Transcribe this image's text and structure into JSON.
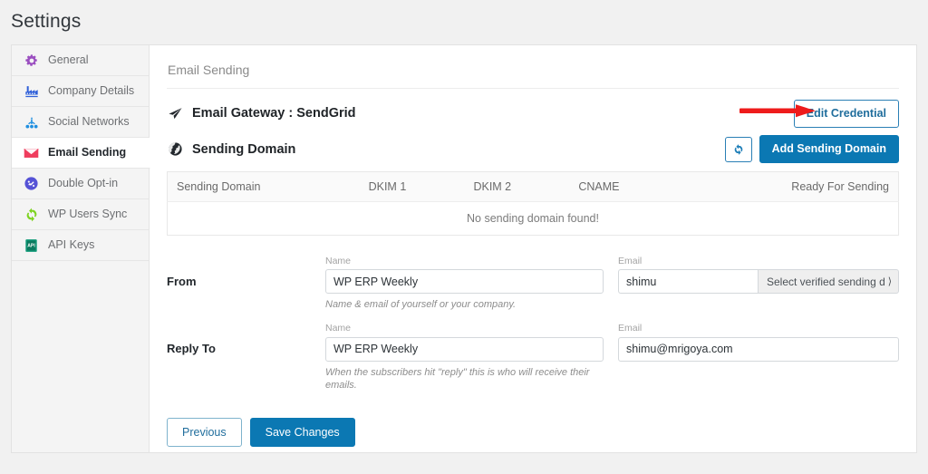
{
  "page": {
    "title": "Settings"
  },
  "sidebar": {
    "items": [
      {
        "label": "General",
        "icon": "gear-icon",
        "color": "#9b4fc0",
        "active": false
      },
      {
        "label": "Company Details",
        "icon": "factory-icon",
        "color": "#2f5fd8",
        "active": false
      },
      {
        "label": "Social Networks",
        "icon": "share-nodes-icon",
        "color": "#1f8fe0",
        "active": false
      },
      {
        "label": "Email Sending",
        "icon": "envelope-icon",
        "color": "#ef3d5e",
        "active": true
      },
      {
        "label": "Double Opt-in",
        "icon": "opt-in-icon",
        "color": "#5552d6",
        "active": false
      },
      {
        "label": "WP Users Sync",
        "icon": "sync-icon",
        "color": "#7ed321",
        "active": false
      },
      {
        "label": "API Keys",
        "icon": "api-keys-icon",
        "color": "#119a78",
        "active": false
      }
    ]
  },
  "content": {
    "heading": "Email Sending",
    "gateway": {
      "icon": "paper-plane-icon",
      "title": "Email Gateway : SendGrid",
      "edit_button": "Edit Credential"
    },
    "sending_domain": {
      "icon": "globe-icon",
      "title": "Sending Domain",
      "refresh_icon": "refresh-icon",
      "add_button": "Add Sending Domain",
      "table": {
        "columns": [
          "Sending Domain",
          "DKIM 1",
          "DKIM 2",
          "CNAME",
          "Ready For Sending"
        ],
        "empty_message": "No sending domain found!"
      }
    },
    "form": {
      "rows": [
        {
          "label": "From",
          "name_label": "Name",
          "name_value": "WP ERP Weekly",
          "name_placeholder": "",
          "email_label": "Email",
          "email_value": "shimu",
          "email_placeholder": "",
          "select_value": "Select verified sending dc",
          "select_chevron": "chevron-down-icon",
          "help": "Name & email of yourself or your company."
        },
        {
          "label": "Reply To",
          "name_label": "Name",
          "name_value": "WP ERP Weekly",
          "name_placeholder": "",
          "email_label": "Email",
          "email_value": "shimu@mrigoya.com",
          "email_placeholder": "",
          "help": "When the subscribers hit \"reply\" this is who will receive their emails."
        }
      ]
    },
    "footer": {
      "previous_label": "Previous",
      "save_label": "Save Changes"
    }
  },
  "annotation": {
    "type": "arrow",
    "color": "#ee1b1b",
    "points_to": "Edit Credential"
  },
  "colors": {
    "accent": "#0b78b3",
    "accent_border": "#2a7fb5",
    "page_bg": "#f1f1f1",
    "sidebar_bg": "#f4f4f4",
    "annotation_red": "#ee1b1b"
  }
}
